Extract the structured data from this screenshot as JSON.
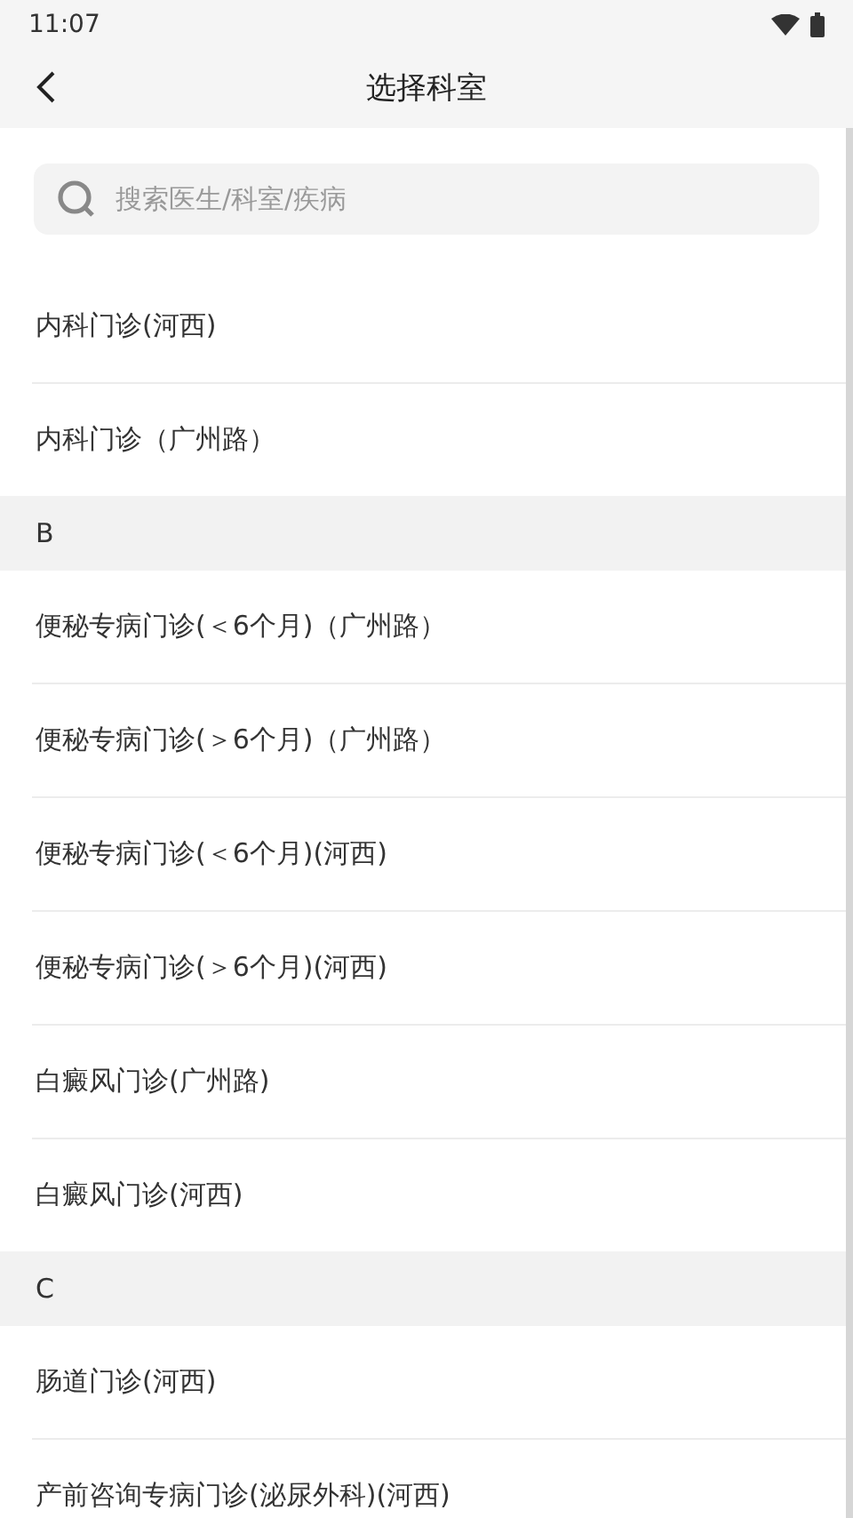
{
  "status_bar": {
    "time": "11:07"
  },
  "header": {
    "title": "选择科室"
  },
  "search": {
    "placeholder": "搜索医生/科室/疾病"
  },
  "entries": [
    {
      "kind": "item",
      "label": "内科门诊(河西)"
    },
    {
      "kind": "item",
      "label": "内科门诊（广州路）"
    },
    {
      "kind": "header",
      "label": "B"
    },
    {
      "kind": "item",
      "label": "便秘专病门诊(＜6个月)（广州路）"
    },
    {
      "kind": "item",
      "label": "便秘专病门诊(＞6个月)（广州路）"
    },
    {
      "kind": "item",
      "label": "便秘专病门诊(＜6个月)(河西)"
    },
    {
      "kind": "item",
      "label": "便秘专病门诊(＞6个月)(河西)"
    },
    {
      "kind": "item",
      "label": "白癜风门诊(广州路)"
    },
    {
      "kind": "item",
      "label": "白癜风门诊(河西)"
    },
    {
      "kind": "header",
      "label": "C"
    },
    {
      "kind": "item",
      "label": "肠道门诊(河西)"
    },
    {
      "kind": "item",
      "label": "产前咨询专病门诊(泌尿外科)(河西)"
    }
  ]
}
